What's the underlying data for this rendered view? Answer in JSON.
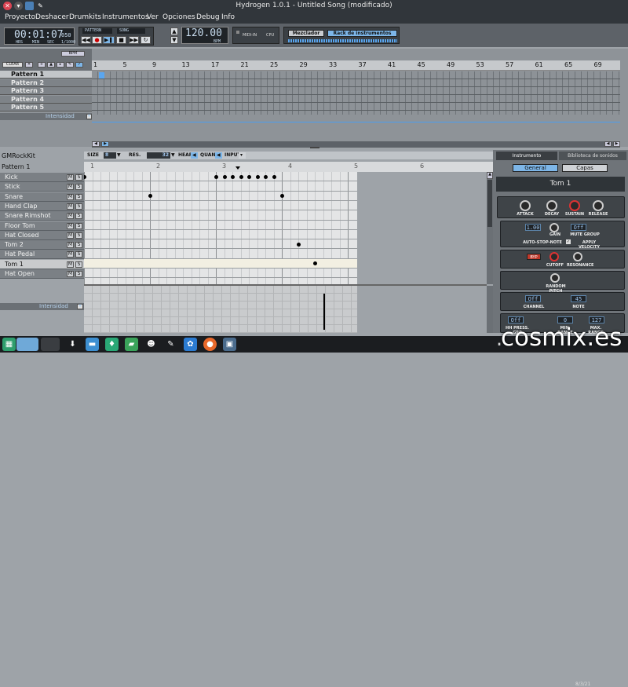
{
  "window": {
    "title": "Hydrogen 1.0.1 - Untitled Song (modificado)"
  },
  "menu": [
    "Proyecto",
    "Deshacer",
    "Drumkits",
    "Instrumentos",
    "Ver",
    "Opciones",
    "Debug",
    "Info"
  ],
  "transport": {
    "time": "00:01:07",
    "time_ms": "050",
    "time_units": [
      "HRS",
      "MIN",
      "SEC",
      "1/1000"
    ],
    "mode_pattern": "PATTERN",
    "mode_song": "SONG",
    "bpm": "120.00",
    "bpm_label": "BPM",
    "midi_label": "MIDI-IN",
    "cpu_label": "CPU",
    "mixer_button": "Mezclador",
    "instrument_rack_button": "Rack de instrumentos"
  },
  "song_editor": {
    "bpm_button": "BPM",
    "clear_button": "CLEAR",
    "ruler": [
      "1",
      "5",
      "9",
      "13",
      "17",
      "21",
      "25",
      "29",
      "33",
      "37",
      "41",
      "45",
      "49",
      "53",
      "57",
      "61",
      "65",
      "69"
    ],
    "patterns": [
      "Pattern 1",
      "Pattern 2",
      "Pattern 3",
      "Pattern 4",
      "Pattern 5"
    ],
    "selected_pattern": 0,
    "intensity_label": "Intensidad"
  },
  "pattern_editor": {
    "drumkit": "GMRockKit",
    "pattern_name": "Pattern 1",
    "size_label": "SIZE",
    "size_value": "8",
    "res_label": "RES.",
    "res_value": "32",
    "hear_label": "HEAR",
    "quant_label": "QUANT",
    "input_label": "INPUT",
    "ruler": [
      "1",
      "2",
      "3",
      "4",
      "5",
      "6"
    ],
    "instruments": [
      "Kick",
      "Stick",
      "Snare",
      "Hand Clap",
      "Snare Rimshot",
      "Floor Tom",
      "Hat Closed",
      "Tom 2",
      "Hat Pedal",
      "Tom 1",
      "Hat Open"
    ],
    "selected_instrument": 9,
    "mute_label": "M",
    "solo_label": "S",
    "velocity_label": "Intensidad"
  },
  "instrument_panel": {
    "tab_instrument": "Instrumento",
    "tab_library": "Biblioteca de sonidos",
    "btn_general": "General",
    "btn_layers": "Capas",
    "instrument_name": "Tom 1",
    "adsr_labels": [
      "ATTACK",
      "DECAY",
      "SUSTAIN",
      "RELEASE"
    ],
    "gain_value": "1.00",
    "gain_label": "GAIN",
    "mute_group_value": "Off",
    "mute_group_label": "MUTE GROUP",
    "auto_stop_label": "AUTO-STOP-NOTE",
    "apply_velocity_label": "APPLY VELOCITY",
    "filter_button": "BYP",
    "cutoff_label": "CUTOFF",
    "resonance_label": "RESONANCE",
    "random_pitch_label": "RANDOM PITCH",
    "channel_value": "Off",
    "channel_label": "CHANNEL",
    "note_value": "45",
    "note_label": "NOTE",
    "hh_press_value": "Off",
    "hh_press_label": "HH PRESS. GRP",
    "min_range_value": "0",
    "min_range_label": "MIN. RANGE",
    "max_range_value": "127",
    "max_range_label": "MAX. RANGE"
  },
  "taskbar": {
    "date": "8/3/21"
  },
  "watermark": "cosmix.es"
}
